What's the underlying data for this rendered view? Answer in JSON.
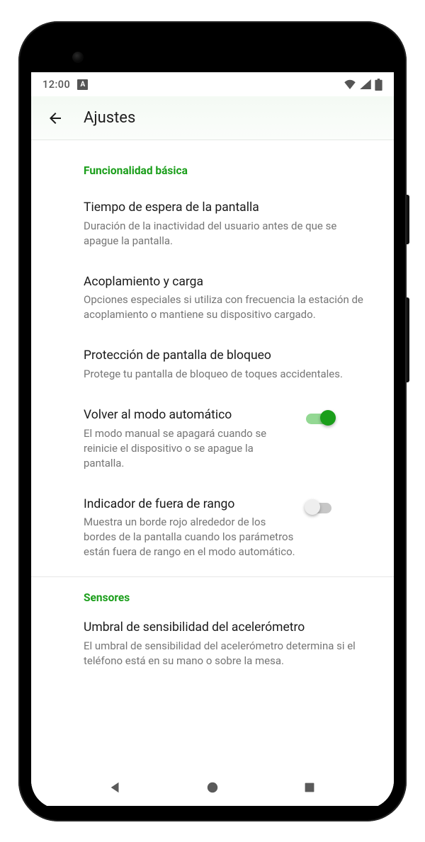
{
  "status": {
    "time": "12:00",
    "badge": "A"
  },
  "appbar": {
    "title": "Ajustes"
  },
  "sections": {
    "basic": {
      "label": "Funcionalidad básica",
      "timeout": {
        "title": "Tiempo de espera de la pantalla",
        "desc": "Duración de la inactividad del usuario antes de que se apague la pantalla."
      },
      "docking": {
        "title": "Acoplamiento y carga",
        "desc": "Opciones especiales si utiliza con frecuencia la estación de acoplamiento o mantiene su dispositivo cargado."
      },
      "lockprotect": {
        "title": "Protección de pantalla de bloqueo",
        "desc": "Protege tu pantalla de bloqueo de toques accidentales."
      },
      "automode": {
        "title": "Volver al modo automático",
        "desc": "El modo manual se apagará cuando se reinicie el dispositivo o se apague la pantalla."
      },
      "outofrange": {
        "title": "Indicador de fuera de rango",
        "desc": "Muestra un borde rojo alrededor de los bordes de la pantalla cuando los parámetros están fuera de rango en el modo automático."
      }
    },
    "sensors": {
      "label": "Sensores",
      "accel": {
        "title": "Umbral de sensibilidad del acelerómetro",
        "desc": "El umbral de sensibilidad del acelerómetro determina si el teléfono está en su mano o sobre la mesa."
      }
    }
  }
}
